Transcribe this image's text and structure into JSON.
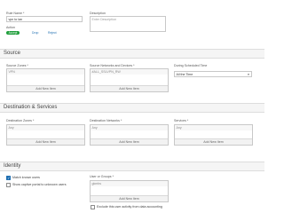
{
  "rule": {
    "name_label": "Rule Name *",
    "name_value": "vpn to lan",
    "description_label": "Description",
    "description_placeholder": "Enter Description",
    "action_label": "Action",
    "actions": [
      "Accept",
      "Drop",
      "Reject"
    ],
    "selected_action": "Accept"
  },
  "source": {
    "section_title": "Source",
    "zones_label": "Source Zones *",
    "zones_items": [
      "VPN"
    ],
    "networks_label": "Source Networks and Devices *",
    "networks_items": [
      "#ALL_SSLVPN_RW"
    ],
    "schedule_label": "During Scheduled Time",
    "schedule_value": "All the Time",
    "add_label": "Add New Item"
  },
  "destination": {
    "section_title": "Destination & Services",
    "zones_label": "Destination Zones *",
    "zones_items": [
      "Any"
    ],
    "networks_label": "Destination Networks *",
    "networks_items": [
      "Any"
    ],
    "services_label": "Services *",
    "services_items": [
      "Any"
    ],
    "add_label": "Add New Item"
  },
  "identity": {
    "section_title": "Identity",
    "match_known_users": "Match known users",
    "match_known_users_checked": true,
    "show_captive_portal": "Show captive portal to unknown users",
    "show_captive_portal_checked": false,
    "user_group_label": "User or Groups *",
    "user_group_items": [
      "gkmbs"
    ],
    "add_label": "Add New Item",
    "exclude_label": "Exclude this user activity from data accounting",
    "exclude_checked": false
  },
  "colors": {
    "accept": "#1f9e3b",
    "link": "#1f6fb2",
    "section_band": "#f5f5f5"
  }
}
